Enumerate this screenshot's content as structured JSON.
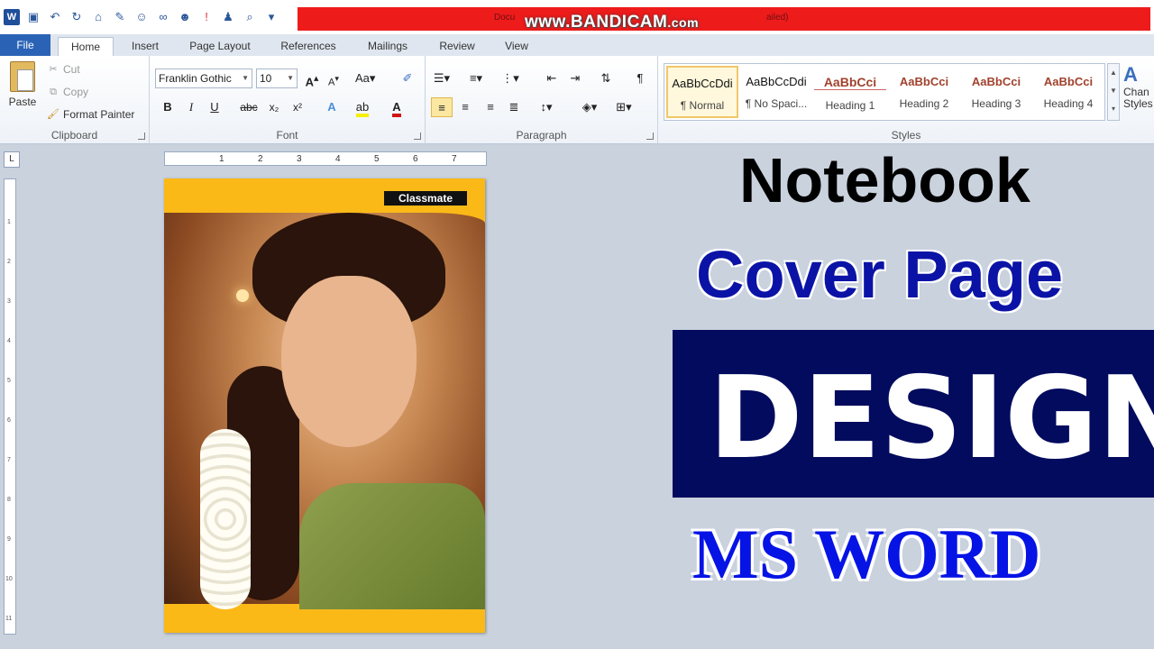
{
  "titlebar": {
    "doc_fragment": "Docu",
    "status_fragment": "ailed)",
    "watermark": "www.BANDICAM",
    "watermark_suffix": ".com"
  },
  "tabs": [
    "File",
    "Home",
    "Insert",
    "Page Layout",
    "References",
    "Mailings",
    "Review",
    "View"
  ],
  "clipboard": {
    "paste": "Paste",
    "cut": "Cut",
    "copy": "Copy",
    "format_painter": "Format Painter",
    "label": "Clipboard"
  },
  "font": {
    "family": "Franklin Gothic",
    "size": "10",
    "grow": "A",
    "shrink": "A",
    "change_case": "Aa",
    "bold": "B",
    "italic": "I",
    "underline": "U",
    "strike": "abc",
    "subscript": "x₂",
    "superscript": "x²",
    "label": "Font",
    "font_color": "#d21414",
    "highlight_color": "#f5f000"
  },
  "paragraph": {
    "pilcrow": "¶",
    "label": "Paragraph"
  },
  "styles": {
    "items": [
      {
        "sample": "AaBbCcDdi",
        "name": "¶ Normal"
      },
      {
        "sample": "AaBbCcDdi",
        "name": "¶ No Spaci..."
      },
      {
        "sample": "AaBbCci",
        "name": "Heading 1"
      },
      {
        "sample": "AaBbCci",
        "name": "Heading 2"
      },
      {
        "sample": "AaBbCci",
        "name": "Heading 3"
      },
      {
        "sample": "AaBbCci",
        "name": "Heading 4"
      }
    ],
    "change_styles": [
      "Chan",
      "Styles"
    ],
    "change_glyph": "A",
    "label": "Styles"
  },
  "ruler": {
    "corner": "L",
    "h_ticks": [
      "1",
      "2",
      "3",
      "4",
      "5",
      "6",
      "7"
    ],
    "v_ticks": [
      "1",
      "2",
      "3",
      "4",
      "5",
      "6",
      "7",
      "8",
      "9",
      "10",
      "11"
    ]
  },
  "cover": {
    "brand": "Classmate"
  },
  "headline": {
    "line1": "Notebook",
    "line2": "Cover Page",
    "line3": "DESIGN",
    "line4": "MS WORD"
  }
}
